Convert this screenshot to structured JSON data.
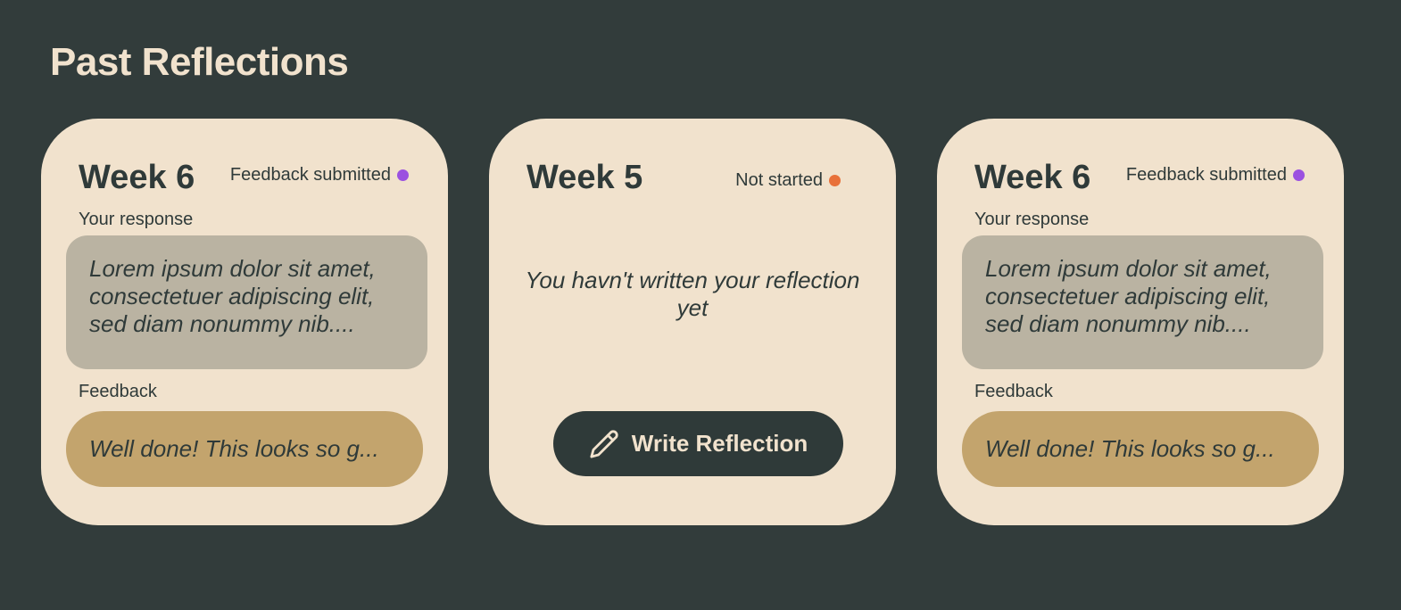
{
  "page": {
    "title": "Past Reflections"
  },
  "colors": {
    "background": "#323c3b",
    "card": "#f1e2cd",
    "response_box": "#bab3a2",
    "feedback_box": "#c3a46d",
    "submitted_dot": "#9b51e0",
    "not_started_dot": "#e8713a"
  },
  "cards": [
    {
      "week": "Week 6",
      "status": "Feedback submitted",
      "response_label": "Your response",
      "response_text": "Lorem ipsum dolor sit amet, consectetuer adipiscing elit, sed diam nonummy nib....",
      "feedback_label": "Feedback",
      "feedback_text": "Well done! This looks so g..."
    },
    {
      "week": "Week 5",
      "status": "Not started",
      "empty_message": "You havn't written your reflection yet",
      "button_label": "Write Reflection",
      "button_icon": "pencil-icon"
    },
    {
      "week": "Week 6",
      "status": "Feedback submitted",
      "response_label": "Your response",
      "response_text": "Lorem ipsum dolor sit amet, consectetuer adipiscing elit, sed diam nonummy nib....",
      "feedback_label": "Feedback",
      "feedback_text": "Well done! This looks so g..."
    }
  ]
}
